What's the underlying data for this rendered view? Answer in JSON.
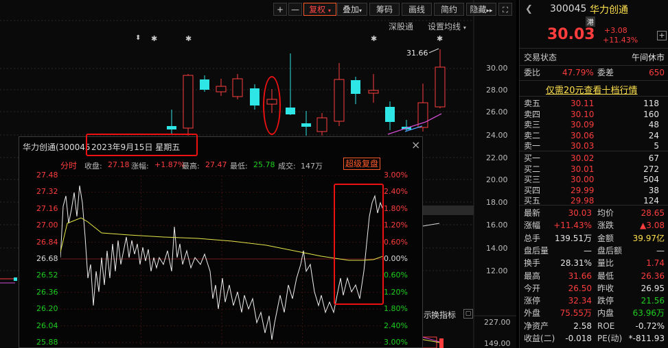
{
  "toolbar": {
    "plus_label": "+",
    "minus_label": "—",
    "fuquan_label": "复权",
    "diejia_label": "叠加",
    "chouma_label": "筹码",
    "huaxian_label": "画线",
    "jianyue_label": "简约",
    "yincang_label": "隐藏",
    "arrows_label": "▸▸",
    "shenguotong_label": "深股通",
    "settings_label": "设置均线"
  },
  "kline": {
    "price_ticks": [
      "30.00",
      "28.00",
      "26.00",
      "24.00",
      "22.00",
      "20.00",
      "18.00",
      "16.00",
      "14.00",
      "12.00"
    ],
    "high_marker": "31.66",
    "volume_ticks": [
      "227.00",
      "149.00"
    ],
    "indicator_tab": "换指标",
    "indicator_tab2": "示",
    "star_marks": [
      "⬍",
      "✱",
      "✱",
      "✱",
      "✱"
    ]
  },
  "popup": {
    "title": "华力创通(300045",
    "date": "2023年9月15日  星期五",
    "mode": "分时",
    "close_label": "收盘:",
    "close_val": "27.18",
    "change_label": "涨幅:",
    "change_val": "+1.87%",
    "high_label": "最高:",
    "high_val": "27.47",
    "low_label": "最低:",
    "low_val": "25.78",
    "vol_label": "成交:",
    "vol_val": "147万",
    "super_label": "超级复盘",
    "left_ticks": [
      "27.48",
      "27.32",
      "27.16",
      "27.00",
      "26.84",
      "26.68",
      "26.52",
      "26.36",
      "26.20",
      "26.04",
      "25.88"
    ],
    "right_ticks": [
      "3.00%",
      "2.40%",
      "1.80%",
      "1.20%",
      "0.60%",
      "0.00%",
      "0.60%",
      "1.20%",
      "1.80%",
      "2.40%",
      "3.00%"
    ]
  },
  "stock": {
    "code": "300045",
    "name": "华力创通",
    "badge": "港",
    "price": "30.03",
    "change": "+3.08",
    "change_pct": "+11.43%",
    "status_label": "交易状态",
    "status_val": "午间休市",
    "weibi_label": "委比",
    "weibi_val": "47.79%",
    "weicha_label": "委差",
    "weicha_val": "650",
    "promo": "仅需20元查看十档行情"
  },
  "asks": [
    {
      "label": "卖五",
      "price": "30.11",
      "vol": "118"
    },
    {
      "label": "卖四",
      "price": "30.10",
      "vol": "160"
    },
    {
      "label": "卖三",
      "price": "30.09",
      "vol": "48"
    },
    {
      "label": "卖二",
      "price": "30.06",
      "vol": "24"
    },
    {
      "label": "卖一",
      "price": "30.03",
      "vol": "5"
    }
  ],
  "bids": [
    {
      "label": "买一",
      "price": "30.02",
      "vol": "67"
    },
    {
      "label": "买二",
      "price": "30.01",
      "vol": "272"
    },
    {
      "label": "买三",
      "price": "30.00",
      "vol": "504"
    },
    {
      "label": "买四",
      "price": "29.99",
      "vol": "38"
    },
    {
      "label": "买五",
      "price": "29.98",
      "vol": "124"
    }
  ],
  "stats": [
    {
      "l1": "最新",
      "v1": "30.03",
      "c1": "red",
      "l2": "均价",
      "v2": "28.65",
      "c2": "red"
    },
    {
      "l1": "涨幅",
      "v1": "+11.43%",
      "c1": "red",
      "l2": "涨跌",
      "v2": "▲3.08",
      "c2": "red"
    },
    {
      "l1": "总手",
      "v1": "139.51万",
      "c1": "white",
      "l2": "金额",
      "v2": "39.97亿",
      "c2": "yellow"
    },
    {
      "l1": "盘后量",
      "v1": "—",
      "c1": "white",
      "l2": "盘后额",
      "v2": "—",
      "c2": "white"
    },
    {
      "l1": "换手",
      "v1": "28.31%",
      "c1": "white",
      "l2": "量比",
      "v2": "1.74",
      "c2": "red"
    },
    {
      "l1": "最高",
      "v1": "31.66",
      "c1": "red",
      "l2": "最低",
      "v2": "26.36",
      "c2": "red"
    },
    {
      "l1": "今开",
      "v1": "26.50",
      "c1": "red",
      "l2": "昨收",
      "v2": "26.95",
      "c2": "white"
    },
    {
      "l1": "涨停",
      "v1": "32.34",
      "c1": "red",
      "l2": "跌停",
      "v2": "21.56",
      "c2": "green"
    },
    {
      "l1": "外盘",
      "v1": "75.55万",
      "c1": "red",
      "l2": "内盘",
      "v2": "63.96万",
      "c2": "green"
    },
    {
      "l1": "净资产",
      "v1": "2.58",
      "c1": "white",
      "l2": "ROE",
      "v2": "-0.72%",
      "c2": "white"
    },
    {
      "l1": "收益(二)",
      "v1": "-0.018",
      "c1": "white",
      "l2": "PE(动)",
      "v2": "*-811.93",
      "c2": "white"
    }
  ],
  "colors": {
    "up": "#ff3d3d",
    "down": "#1ecf1e",
    "cyan": "#2ee6e6",
    "avg": "#e8e84a",
    "price_line": "#ffffff"
  }
}
